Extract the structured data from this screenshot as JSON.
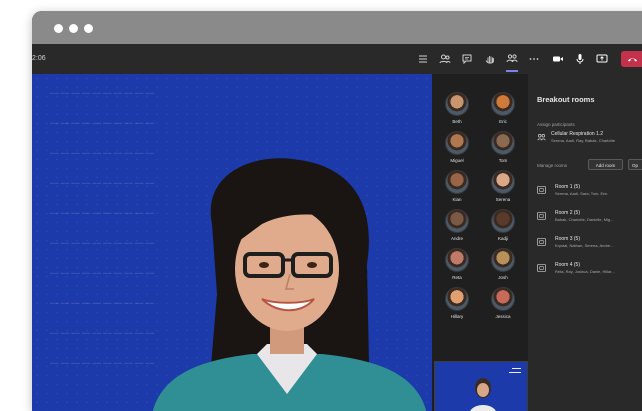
{
  "window": {
    "time": "2:06"
  },
  "toolbar": {
    "icons": [
      "list-icon",
      "people-icon",
      "chat-icon",
      "raise-hand-icon",
      "breakout-rooms-icon",
      "more-icon",
      "camera-icon",
      "mic-icon",
      "share-icon",
      "hang-up-icon"
    ]
  },
  "colors": {
    "accent": "#7b83eb",
    "hangup": "#c4314b",
    "stage_bg": "#1c3aa9",
    "panel_bg": "#292929"
  },
  "gallery": {
    "participants": [
      {
        "name": "Beth",
        "color": "#c8966e"
      },
      {
        "name": "Eric",
        "color": "#d07a3a"
      },
      {
        "name": "Miguel",
        "color": "#b07850"
      },
      {
        "name": "Tom",
        "color": "#8a6a50"
      },
      {
        "name": "Kian",
        "color": "#9a6448"
      },
      {
        "name": "Serena",
        "color": "#d8a888"
      },
      {
        "name": "Andre",
        "color": "#7a5a44"
      },
      {
        "name": "Kadji",
        "color": "#5a3a2a"
      },
      {
        "name": "Reta",
        "color": "#c07a6a"
      },
      {
        "name": "Josh",
        "color": "#b8905a"
      },
      {
        "name": "Hillary",
        "color": "#e0a070"
      },
      {
        "name": "Jessica",
        "color": "#c86a5a"
      }
    ]
  },
  "panel": {
    "title": "Breakout rooms",
    "assign_label": "Assign participants",
    "assign_name": "Cellular Respiration 1.2",
    "assign_members": "Serena, Aadi, Ray, Babak, Charlotte",
    "manage_label": "Manage rooms",
    "add_room": "Add room",
    "open_label": "Op",
    "rooms": [
      {
        "name": "Room 1 (5)",
        "members": "Serena, Aadi, Sara, Tom, Eric"
      },
      {
        "name": "Room 2 (5)",
        "members": "Babak, Charlotte, Danielle, Mig..."
      },
      {
        "name": "Room 3 (5)",
        "members": "Krystal, Nathan, Serena, Andre..."
      },
      {
        "name": "Room 4 (5)",
        "members": "Reta, Ray, Joshua, Danie, Hillar..."
      }
    ]
  }
}
